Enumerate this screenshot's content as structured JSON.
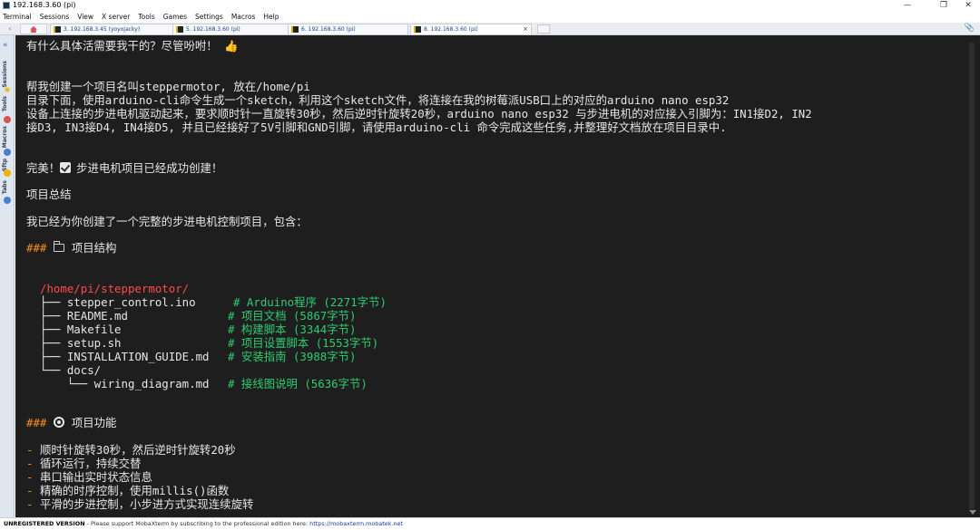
{
  "window": {
    "title": "192.168.3.60 (pi)",
    "controls": {
      "minimize": "—",
      "maximize": "❐",
      "close": "✕"
    }
  },
  "menubar": [
    "Terminal",
    "Sessions",
    "View",
    "X server",
    "Tools",
    "Games",
    "Settings",
    "Macros",
    "Help"
  ],
  "tabs": [
    {
      "label": "3. 192.168.3.45 (yoyojacky)",
      "active": false
    },
    {
      "label": "5. 192.168.3.60 (pi)",
      "active": false
    },
    {
      "label": "6. 192.168.3.60 (pi)",
      "active": false
    },
    {
      "label": "8. 192.168.3.60 (pi)",
      "active": true,
      "close": "×"
    }
  ],
  "sidebar": [
    "Sessions",
    "Tools",
    "Macros",
    "Sftp",
    "Tabs"
  ],
  "terminal": {
    "line1": "有什么具体活需要我干的？尽管吩咐！ 👍",
    "request": [
      "帮我创建一个项目名叫steppermotor, 放在/home/pi",
      "目录下面，使用arduino-cli命令生成一个sketch，利用这个sketch文件，将连接在我的树莓派USB口上的对应的arduino nano esp32",
      "设备上连接的步进电机驱动起来，要求顺时针一直旋转30秒，然后逆时针旋转20秒，arduino nano esp32 与步进电机的对应接入引脚为：IN1接D2, IN2",
      "接D3, IN3接D4, IN4接D5, 并且已经接好了5V引脚和GND引脚，请使用arduino-cli 命令完成这些任务,并整理好文档放在项目目录中."
    ],
    "success": "完美！",
    "success_rest": "步进电机项目已经成功创建！",
    "summary_title": "项目总结",
    "summary_text": "我已经为你创建了一个完整的步进电机控制项目，包含：",
    "heading_prefix": "###",
    "structure_heading": "项目结构",
    "root_path": "/home/pi/steppermotor/",
    "tree": [
      {
        "branch": "├── ",
        "name": "stepper_control.ino",
        "comment": "# Arduino程序 (2271字节)"
      },
      {
        "branch": "├── ",
        "name": "README.md",
        "comment": "# 项目文档 (5867字节)"
      },
      {
        "branch": "├── ",
        "name": "Makefile",
        "comment": "# 构建脚本 (3344字节)"
      },
      {
        "branch": "├── ",
        "name": "setup.sh",
        "comment": "# 项目设置脚本 (1553字节)"
      },
      {
        "branch": "├── ",
        "name": "INSTALLATION_GUIDE.md",
        "comment": "# 安装指南 (3988字节)"
      },
      {
        "branch": "└── ",
        "name": "docs/",
        "comment": ""
      },
      {
        "branch": "    └── ",
        "name": "wiring_diagram.md",
        "comment": "# 接线图说明 (5636字节)"
      }
    ],
    "features_heading": "项目功能",
    "bullet": "-",
    "features": [
      "顺时针旋转30秒，然后逆时针旋转20秒",
      "循环运行，持续交替",
      "串口输出实时状态信息",
      "精确的时序控制，使用millis()函数",
      "平滑的步进控制，小步进方式实现连续旋转"
    ]
  },
  "statusbar": {
    "unregistered": "UNREGISTERED VERSION",
    "message": "  -  Please support MobaXterm by subscribing to the professional edition here:  ",
    "link": "https://mobaxterm.mobatek.net"
  },
  "colors": {
    "terminal_bg": "#1e1e1e",
    "heading": "#ff8c1a",
    "path": "#ff4a4a",
    "comment": "#2ecc71"
  }
}
